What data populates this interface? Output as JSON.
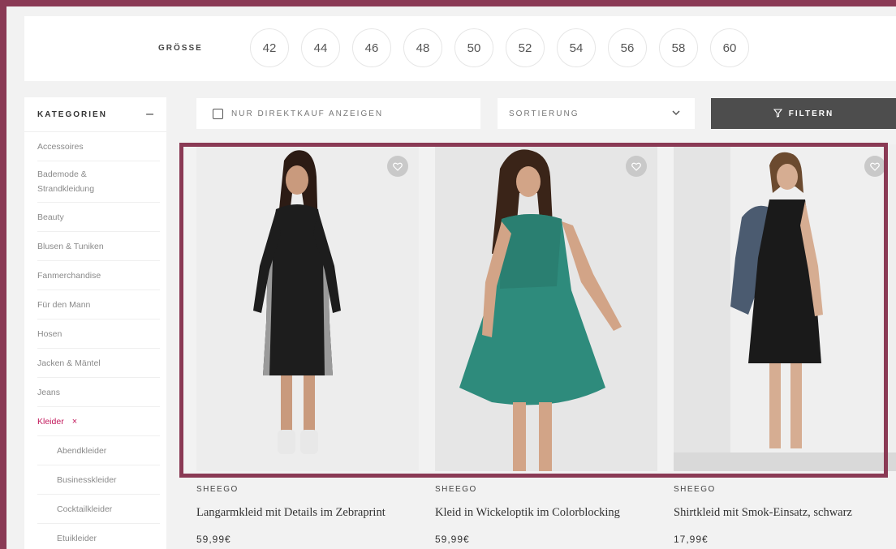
{
  "sizes": {
    "label": "GRÖSSE",
    "options": [
      "42",
      "44",
      "46",
      "48",
      "50",
      "52",
      "54",
      "56",
      "58",
      "60"
    ]
  },
  "sidebar": {
    "title": "KATEGORIEN",
    "collapse_symbol": "–",
    "items": [
      {
        "label": "Accessoires"
      },
      {
        "label": "Bademode & Strandkleidung"
      },
      {
        "label": "Beauty"
      },
      {
        "label": "Blusen & Tuniken"
      },
      {
        "label": "Fanmerchandise"
      },
      {
        "label": "Für den Mann"
      },
      {
        "label": "Hosen"
      },
      {
        "label": "Jacken & Mäntel"
      },
      {
        "label": "Jeans"
      },
      {
        "label": "Kleider"
      },
      {
        "label": "Abendkleider"
      },
      {
        "label": "Businesskleider"
      },
      {
        "label": "Cocktailkleider"
      },
      {
        "label": "Etuikleider"
      }
    ],
    "active_remove_symbol": "×"
  },
  "toolbar": {
    "direct_buy_label": "NUR DIREKTKAUF ANZEIGEN",
    "sort_label": "SORTIERUNG",
    "filter_label": "FILTERN"
  },
  "products": [
    {
      "brand": "SHEEGO",
      "name": "Langarmkleid mit Details im Zebraprint",
      "price": "59,99€",
      "dress_color": "#1d1d1d"
    },
    {
      "brand": "SHEEGO",
      "name": "Kleid in Wickeloptik im Colorblocking",
      "price": "59,99€",
      "dress_color": "#2e8b7c"
    },
    {
      "brand": "SHEEGO",
      "name": "Shirtkleid mit Smok-Einsatz, schwarz",
      "price": "17,99€",
      "dress_color": "#1a1a1a"
    }
  ],
  "colors": {
    "accent": "#8a3a55",
    "active_category": "#c2185b",
    "filter_button": "#4d4d4d"
  },
  "icons": {
    "favorite": "heart-icon",
    "filter": "funnel-icon",
    "sort": "chevron-down-icon"
  }
}
